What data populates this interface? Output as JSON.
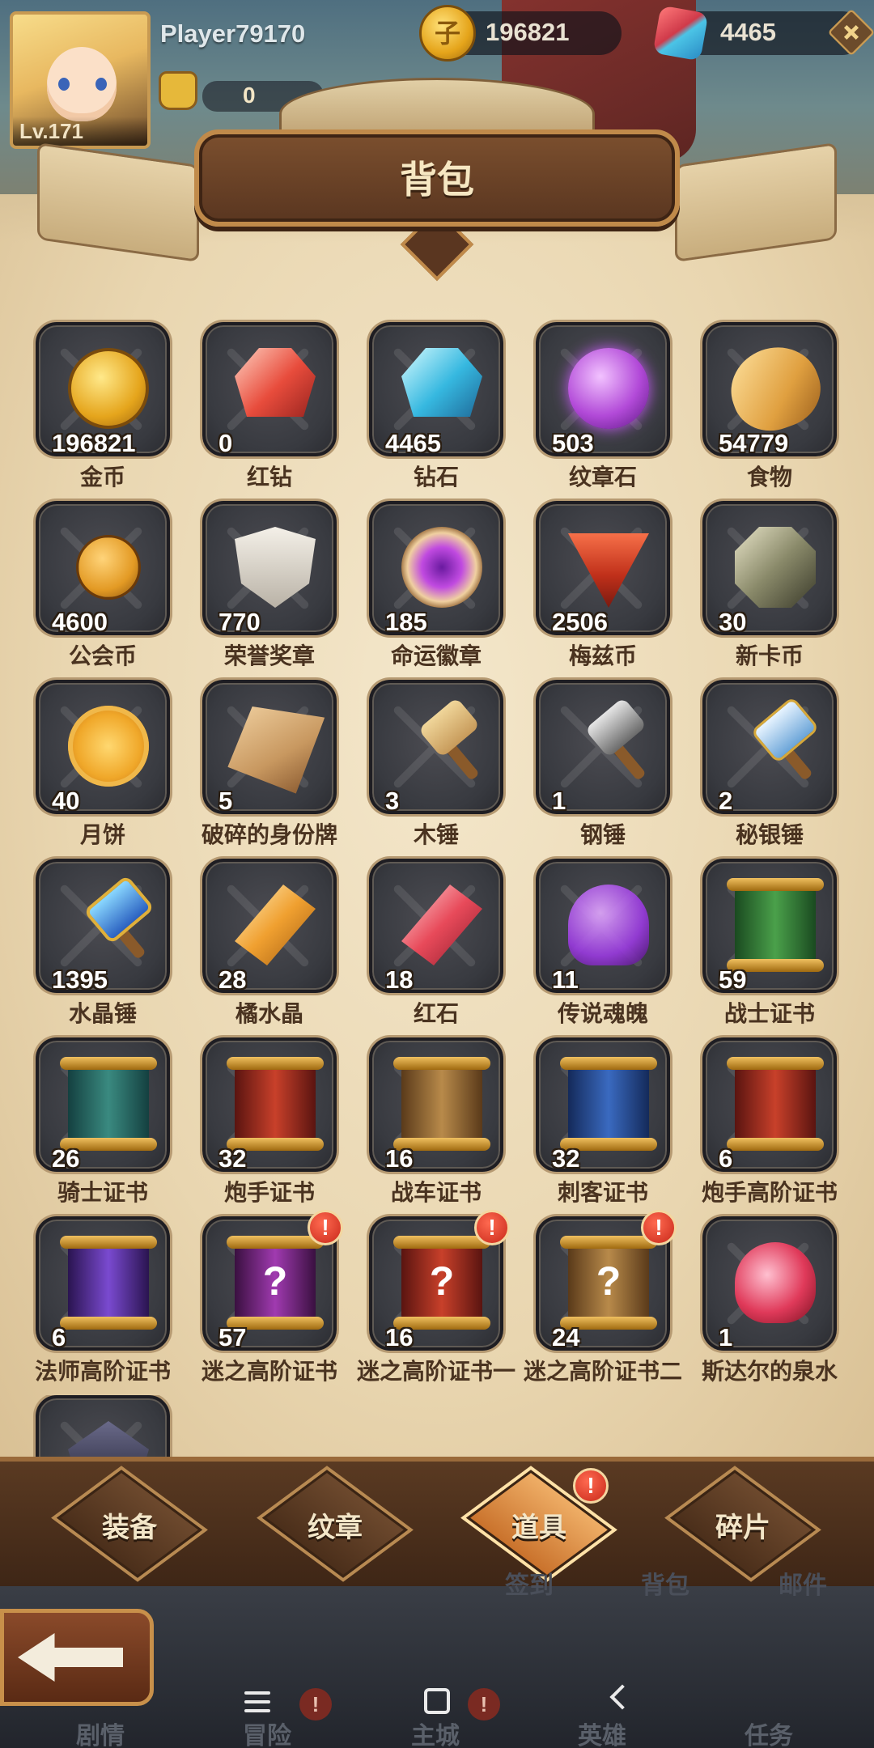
{
  "player": {
    "name": "Player79170",
    "level": "Lv.171",
    "power": "0"
  },
  "resources": {
    "gold": "196821",
    "gems": "4465"
  },
  "panel": {
    "title": "背包"
  },
  "items": [
    {
      "name": "金币",
      "count": "196821",
      "icon": "gold-coin-icon",
      "rarity": "#e0c040"
    },
    {
      "name": "红钻",
      "count": "0",
      "icon": "red-diamond-icon",
      "rarity": "#d8405a"
    },
    {
      "name": "钻石",
      "count": "4465",
      "icon": "diamond-icon",
      "rarity": "#d8405a"
    },
    {
      "name": "纹章石",
      "count": "503",
      "icon": "emblem-stone-icon",
      "rarity": "#4ab03a"
    },
    {
      "name": "食物",
      "count": "54779",
      "icon": "bread-icon",
      "rarity": "#4ab03a"
    },
    {
      "name": "公会币",
      "count": "4600",
      "icon": "guild-coin-icon",
      "rarity": "#4ab03a"
    },
    {
      "name": "荣誉奖章",
      "count": "770",
      "icon": "honor-medal-icon",
      "rarity": "#8a6a52"
    },
    {
      "name": "命运徽章",
      "count": "185",
      "icon": "fate-badge-icon",
      "rarity": "#8a6a52"
    },
    {
      "name": "梅兹币",
      "count": "2506",
      "icon": "mez-coin-icon",
      "rarity": "#4ab03a"
    },
    {
      "name": "新卡币",
      "count": "30",
      "icon": "new-card-coin-icon",
      "rarity": "#e0c040"
    },
    {
      "name": "月饼",
      "count": "40",
      "icon": "mooncake-icon",
      "rarity": "#e0c040"
    },
    {
      "name": "破碎的身份牌",
      "count": "5",
      "icon": "broken-id-tag-icon",
      "rarity": "#e0c040"
    },
    {
      "name": "木锤",
      "count": "3",
      "icon": "wooden-hammer-icon",
      "rarity": "#4ab03a"
    },
    {
      "name": "钢锤",
      "count": "1",
      "icon": "steel-hammer-icon",
      "rarity": "#9a4ac8"
    },
    {
      "name": "秘银锤",
      "count": "2",
      "icon": "mithril-hammer-icon",
      "rarity": "#e0c040"
    },
    {
      "name": "水晶锤",
      "count": "1395",
      "icon": "crystal-hammer-icon",
      "rarity": "#e0c040"
    },
    {
      "name": "橘水晶",
      "count": "28",
      "icon": "orange-crystal-icon",
      "rarity": "#e8a030"
    },
    {
      "name": "红石",
      "count": "18",
      "icon": "red-stone-icon",
      "rarity": "#d8405a"
    },
    {
      "name": "传说魂魄",
      "count": "11",
      "icon": "legend-soul-icon",
      "rarity": "#9a4ac8"
    },
    {
      "name": "战士证书",
      "count": "59",
      "icon": "warrior-cert-icon",
      "rarity": "#3a7ad0"
    },
    {
      "name": "骑士证书",
      "count": "26",
      "icon": "knight-cert-icon",
      "rarity": "#3a7ad0"
    },
    {
      "name": "炮手证书",
      "count": "32",
      "icon": "gunner-cert-icon",
      "rarity": "#3a7ad0"
    },
    {
      "name": "战车证书",
      "count": "16",
      "icon": "chariot-cert-icon",
      "rarity": "#3a7ad0"
    },
    {
      "name": "刺客证书",
      "count": "32",
      "icon": "assassin-cert-icon",
      "rarity": "#3a7ad0"
    },
    {
      "name": "炮手高阶证书",
      "count": "6",
      "icon": "gunner-adv-cert-icon",
      "rarity": "#e0c040"
    },
    {
      "name": "法师高阶证书",
      "count": "6",
      "icon": "mage-adv-cert-icon",
      "rarity": "#e0c040"
    },
    {
      "name": "迷之高阶证书",
      "count": "57",
      "icon": "mystery-adv-cert-icon",
      "rarity": "#e0c040",
      "alert": "!"
    },
    {
      "name": "迷之高阶证书一",
      "count": "16",
      "icon": "mystery-adv-cert-1-icon",
      "rarity": "#e0c040",
      "alert": "!"
    },
    {
      "name": "迷之高阶证书二",
      "count": "24",
      "icon": "mystery-adv-cert-2-icon",
      "rarity": "#e0c040",
      "alert": "!"
    },
    {
      "name": "斯达尔的泉水",
      "count": "1",
      "icon": "spring-water-icon",
      "rarity": "#d8405a"
    },
    {
      "name": "",
      "count": "",
      "icon": "dark-crystal-icon",
      "rarity": "#e0c040"
    }
  ],
  "tabs": [
    {
      "label": "装备",
      "active": false
    },
    {
      "label": "纹章",
      "active": false
    },
    {
      "label": "道具",
      "active": true,
      "alert": "!"
    },
    {
      "label": "碎片",
      "active": false
    }
  ],
  "sub_menu": [
    "签到",
    "背包",
    "邮件"
  ],
  "game_nav": [
    {
      "label": "剧情"
    },
    {
      "label": "冒险",
      "alert": "!"
    },
    {
      "label": "主城",
      "alert": "!"
    },
    {
      "label": "英雄"
    },
    {
      "label": "任务"
    }
  ]
}
